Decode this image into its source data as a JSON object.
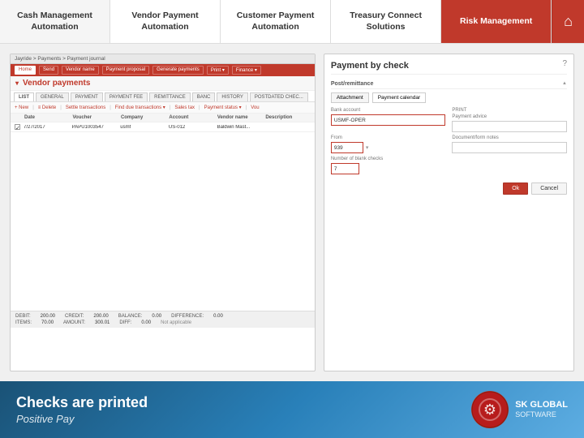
{
  "nav": {
    "items": [
      {
        "id": "cash-management",
        "label": "Cash Management\nAutomation",
        "active": false
      },
      {
        "id": "vendor-payment",
        "label": "Vendor  Payment\nAutomation",
        "active": false
      },
      {
        "id": "customer-payment",
        "label": "Customer Payment\nAutomation",
        "active": false
      },
      {
        "id": "treasury-connect",
        "label": "Treasury Connect\nSolutions",
        "active": false
      },
      {
        "id": "risk-management",
        "label": "Risk Management",
        "active": true
      }
    ],
    "home_icon": "⌂"
  },
  "left_panel": {
    "breadcrumb": "Jayride > Payments > Payment journal",
    "toolbar_buttons": [
      "Home",
      "Send",
      "Vendor name",
      "Payment proposal",
      "Generate payments",
      "Print v",
      "Finance v",
      "Print v"
    ],
    "title": "Vendor payments",
    "tabs": [
      "LIST",
      "GENERAL",
      "PAYMENT",
      "PAYMENT FEE",
      "REMITTANCE",
      "BANC",
      "HISTORY",
      "POSTDATED CHEC..."
    ],
    "action_buttons": [
      "+ New",
      "≡ Delete",
      "Settle transactions",
      "Find due transactions v",
      "Sales tax",
      "Payment status v",
      "Vou"
    ],
    "columns": [
      "Date",
      "Voucher",
      "Company",
      "Account",
      "Vendor name",
      "Description"
    ],
    "row": {
      "checkbox": true,
      "date": "7/27/2017",
      "voucher": "PAPU1003547",
      "company": "usmf",
      "account": "US-012",
      "vendor_name": "Baldwin Mast...",
      "description": ""
    },
    "footer_rows": [
      {
        "label": "DEBIT:",
        "value": "200.00"
      },
      {
        "label": "CREDIT:",
        "value": "200.00"
      },
      {
        "label": "BALANCE:",
        "value": "0.00"
      },
      {
        "label": "DIFFERENCE:",
        "value": "0.00"
      }
    ],
    "footer_row2": [
      {
        "label": "ITEMS:",
        "value": "70.00"
      },
      {
        "label": "AMOUNT:",
        "value": "300.01"
      },
      {
        "label": "DIFF:",
        "value": "0.00"
      },
      {
        "label": "Not applicable"
      }
    ]
  },
  "right_panel": {
    "title": "Payment by check",
    "question_mark": "?",
    "section_title": "Post/remittance",
    "tabs": [
      "Attachment",
      "Payment calendar"
    ],
    "fields": {
      "bank_account_label": "Bank account",
      "bank_account_value": "USMF-OPER",
      "payment_advice_label": "Payment advice",
      "payment_advice_value": "",
      "from_label": "From",
      "from_value": "939",
      "document_num_label": "Document/form notes",
      "document_num_value": "",
      "number_of_checks_label": "Number of blank checks",
      "number_of_checks_value": "7"
    },
    "buttons": {
      "ok": "Ok",
      "cancel": "Cancel"
    }
  },
  "bottom_bar": {
    "main_text": "Checks are printed",
    "sub_text": "Positive Pay",
    "logo_text": "SK GLOBAL",
    "logo_subtext": "SOFTWARE"
  },
  "colors": {
    "red": "#c0392b",
    "dark_red": "#a93226",
    "blue_gradient_start": "#1a5276",
    "blue_gradient_end": "#5dade2"
  }
}
